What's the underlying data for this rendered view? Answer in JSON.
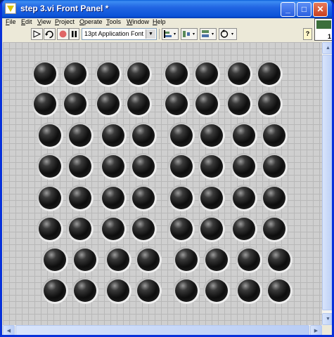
{
  "window": {
    "title": "step 3.vi Front Panel *"
  },
  "title_buttons": {
    "minimize": "_",
    "maximize": "□",
    "close": "✕"
  },
  "menu": [
    "File",
    "Edit",
    "View",
    "Project",
    "Operate",
    "Tools",
    "Window",
    "Help"
  ],
  "toolbar": {
    "run_icon": "run-arrow-icon",
    "continuous_run_icon": "continuous-run-icon",
    "abort_icon": "abort-stop-icon",
    "pause_icon": "pause-icon",
    "font_selector": "13pt Application Font",
    "align_icon": "align-objects-icon",
    "distribute_icon": "distribute-objects-icon",
    "resize_icon": "resize-objects-icon",
    "reorder_icon": "reorder-objects-icon",
    "help_label": "?"
  },
  "connector_pane": {
    "terminal_count": "1"
  },
  "panel": {
    "indicator_type": "round LED",
    "led_color": "#111111",
    "rows": 8,
    "columns": 8,
    "led_states": [
      [
        false,
        false,
        false,
        false,
        false,
        false,
        false,
        false
      ],
      [
        false,
        false,
        false,
        false,
        false,
        false,
        false,
        false
      ],
      [
        false,
        false,
        false,
        false,
        false,
        false,
        false,
        false
      ],
      [
        false,
        false,
        false,
        false,
        false,
        false,
        false,
        false
      ],
      [
        false,
        false,
        false,
        false,
        false,
        false,
        false,
        false
      ],
      [
        false,
        false,
        false,
        false,
        false,
        false,
        false,
        false
      ],
      [
        false,
        false,
        false,
        false,
        false,
        false,
        false,
        false
      ],
      [
        false,
        false,
        false,
        false,
        false,
        false,
        false,
        false
      ]
    ]
  },
  "colors": {
    "title_bar": "#0b54d8",
    "chrome": "#ece9d8",
    "panel_background": "#cfcfcf",
    "grid": "#b8b8b8"
  }
}
